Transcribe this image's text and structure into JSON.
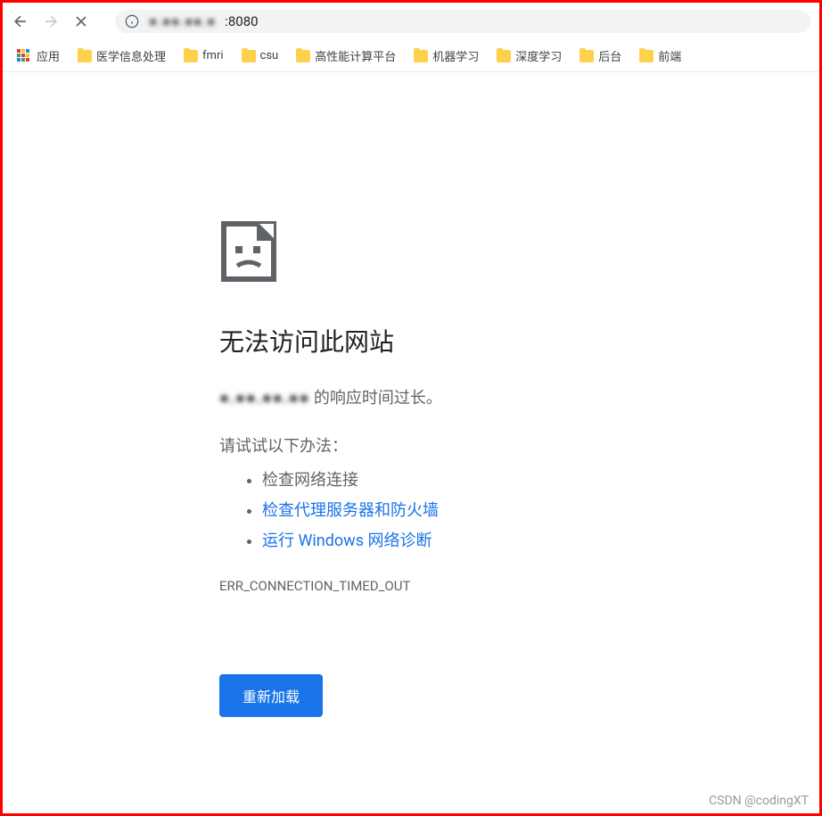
{
  "toolbar": {
    "url_host_obscured": "●.●●.●●.●",
    "url_port": ":8080"
  },
  "bookmarks": {
    "apps_label": "应用",
    "items": [
      {
        "label": "医学信息处理"
      },
      {
        "label": "fmri"
      },
      {
        "label": "csu"
      },
      {
        "label": "高性能计算平台"
      },
      {
        "label": "机器学习"
      },
      {
        "label": "深度学习"
      },
      {
        "label": "后台"
      },
      {
        "label": "前端"
      }
    ]
  },
  "error": {
    "title": "无法访问此网站",
    "host_obscured": "●.●●.●●.●●",
    "desc_suffix": " 的响应时间过长。",
    "suggestions_title": "请试试以下办法：",
    "suggestion_1": "检查网络连接",
    "suggestion_2": "检查代理服务器和防火墙",
    "suggestion_3": "运行 Windows 网络诊断",
    "error_code": "ERR_CONNECTION_TIMED_OUT",
    "reload_label": "重新加载"
  },
  "watermark": "CSDN @codingXT"
}
